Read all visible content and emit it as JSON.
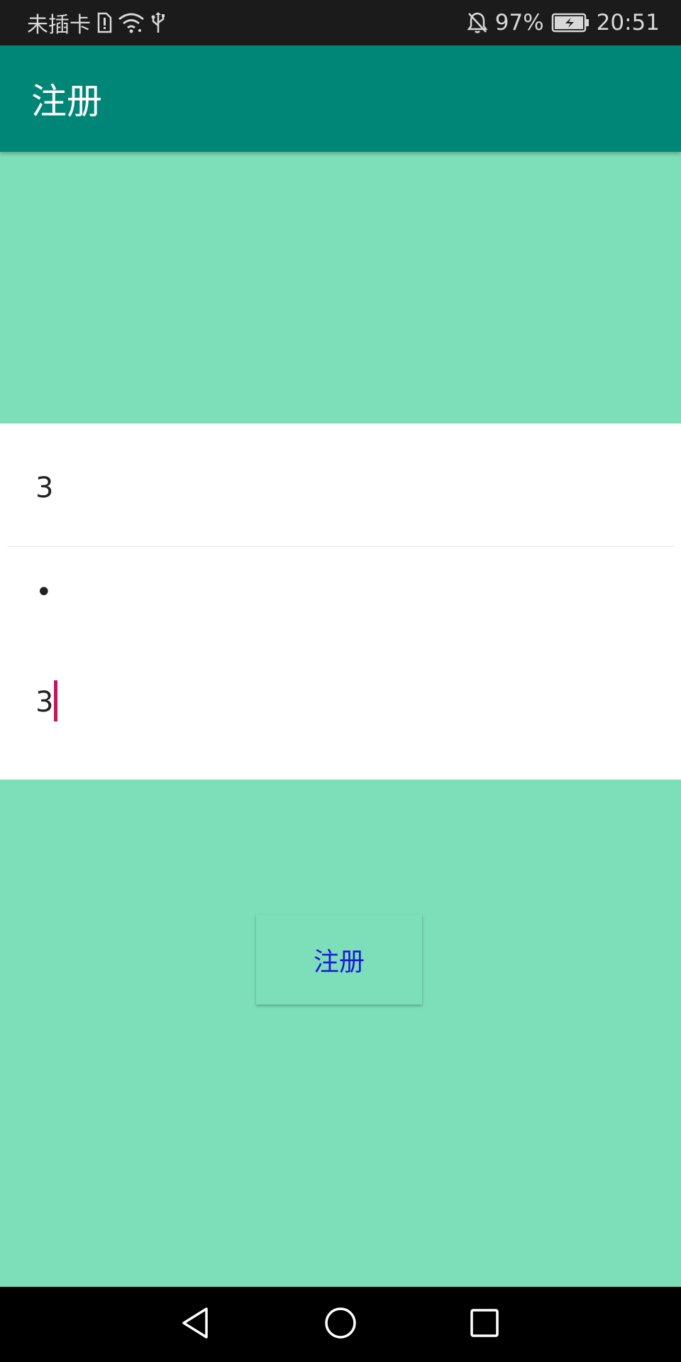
{
  "status_bar": {
    "carrier": "未插卡",
    "battery_percent": "97%",
    "time": "20:51",
    "icons": [
      "sim-alert-icon",
      "wifi-icon",
      "usb-icon",
      "bell-off-icon",
      "battery-charging-icon"
    ]
  },
  "app_bar": {
    "title": "注册"
  },
  "form": {
    "username_value": "3",
    "password_value": "•",
    "confirm_value": "3"
  },
  "register_button": {
    "label": "注册"
  },
  "nav_bar": {
    "icons": [
      "back-icon",
      "home-icon",
      "recents-icon"
    ]
  },
  "colors": {
    "app_bar": "#008676",
    "background": "#7ddfb9",
    "button_text": "#1a1adb",
    "cursor": "#c2185b"
  }
}
